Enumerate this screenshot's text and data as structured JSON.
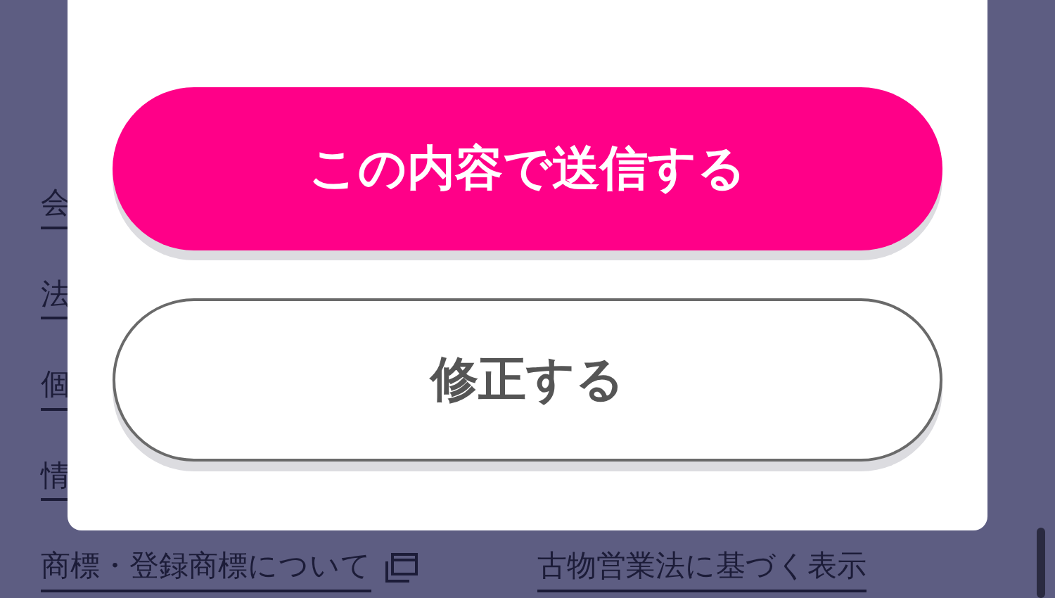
{
  "footer_links": [
    {
      "label": "会"
    },
    {
      "label": "法"
    },
    {
      "label": "個"
    },
    {
      "label": "情"
    }
  ],
  "footer_bottom_links": [
    {
      "label": "商標・登録商標について",
      "external": true
    },
    {
      "label": "古物営業法に基づく表示",
      "external": false
    }
  ],
  "modal": {
    "buttons": [
      {
        "label": "この内容で送信する",
        "kind": "primary"
      },
      {
        "label": "修正する",
        "kind": "secondary"
      }
    ]
  }
}
